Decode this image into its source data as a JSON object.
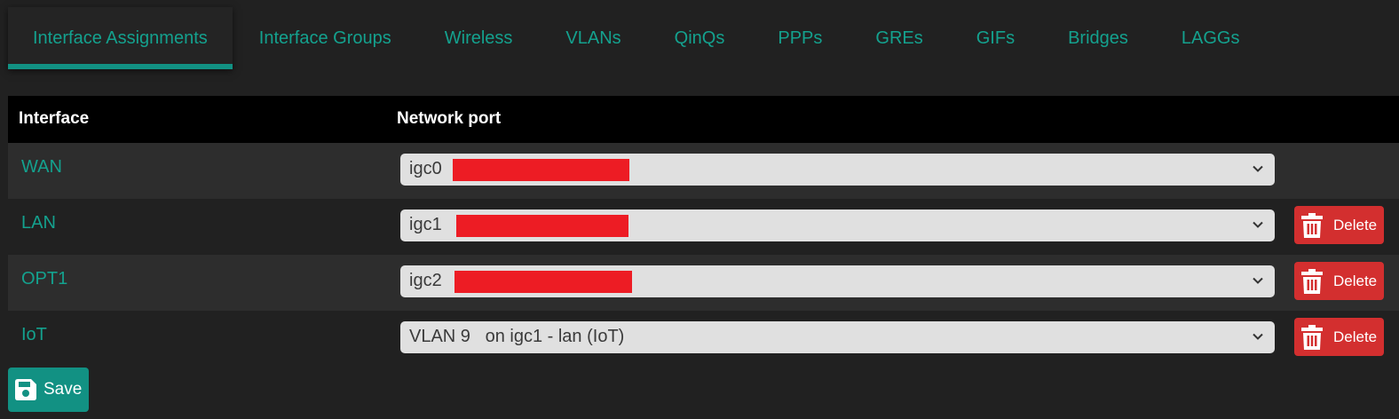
{
  "tabs": [
    {
      "label": "Interface Assignments",
      "active": true
    },
    {
      "label": "Interface Groups"
    },
    {
      "label": "Wireless"
    },
    {
      "label": "VLANs"
    },
    {
      "label": "QinQs"
    },
    {
      "label": "PPPs"
    },
    {
      "label": "GREs"
    },
    {
      "label": "GIFs"
    },
    {
      "label": "Bridges"
    },
    {
      "label": "LAGGs"
    }
  ],
  "table": {
    "headers": {
      "interface": "Interface",
      "network_port": "Network port"
    },
    "rows": [
      {
        "interface": "WAN",
        "port": "igc0"
      },
      {
        "interface": "LAN",
        "port": "igc1",
        "delete_label": "Delete"
      },
      {
        "interface": "OPT1",
        "port": "igc2",
        "delete_label": "Delete"
      },
      {
        "interface": "IoT",
        "port": "VLAN 9   on igc1 - lan (IoT)",
        "delete_label": "Delete"
      }
    ]
  },
  "save_label": "Save",
  "icons": {
    "delete": "trash-icon",
    "save": "floppy-disk-icon",
    "select": "chevron-down-icon"
  },
  "colors": {
    "accent": "#129183",
    "link": "#14A18E",
    "danger": "#D32F2F",
    "redaction": "#ED1C24"
  }
}
